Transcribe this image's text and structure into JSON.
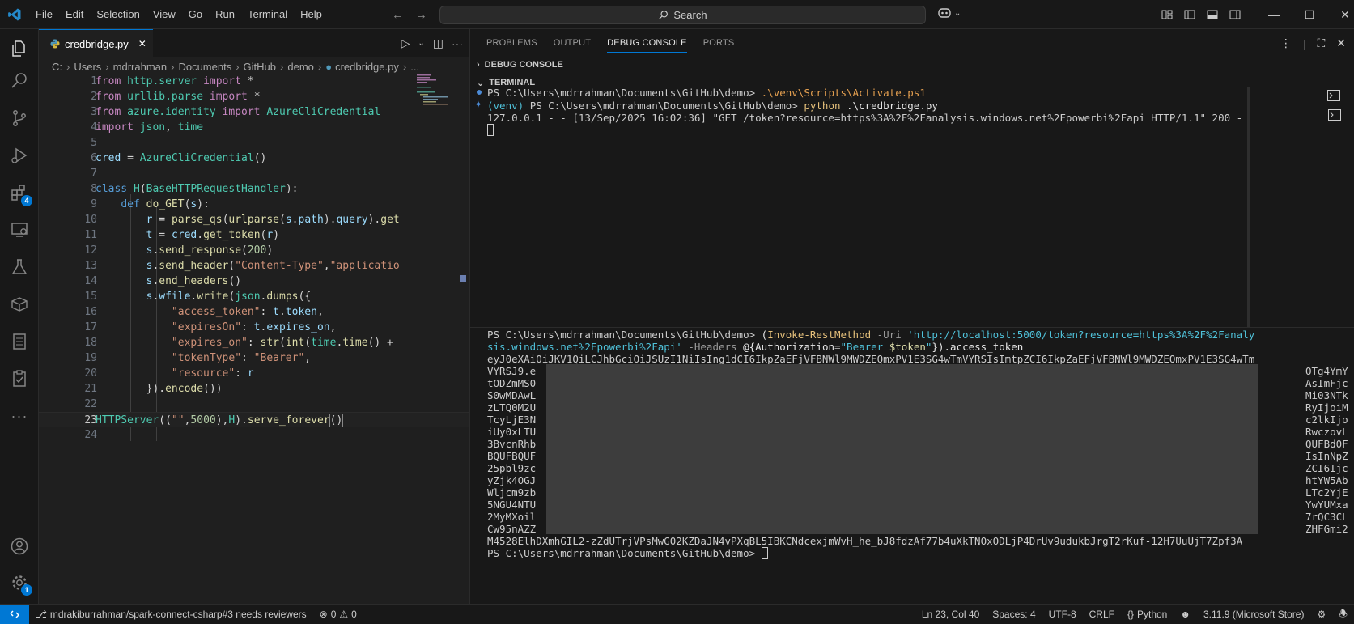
{
  "titlebar": {
    "menu": [
      "File",
      "Edit",
      "Selection",
      "View",
      "Go",
      "Run",
      "Terminal",
      "Help"
    ],
    "search_label": "Search"
  },
  "editor": {
    "tab_label": "credbridge.py",
    "breadcrumb": [
      "C:",
      "Users",
      "mdrrahman",
      "Documents",
      "GitHub",
      "demo",
      "credbridge.py",
      "..."
    ],
    "current_line": 23
  },
  "activity": {
    "extensions_badge": "4",
    "accounts_badge": "1"
  },
  "panel": {
    "tabs": [
      "PROBLEMS",
      "OUTPUT",
      "DEBUG CONSOLE",
      "PORTS"
    ],
    "active_tab": "DEBUG CONSOLE",
    "debug_console_header": "DEBUG CONSOLE",
    "terminal_header": "TERMINAL"
  },
  "terminal": {
    "line1_prompt": "PS C:\\Users\\mdrrahman\\Documents\\GitHub\\demo> ",
    "line1_cmd": ".\\venv\\Scripts\\Activate.ps1",
    "line2_venv": "(venv) ",
    "line2_prompt": "PS C:\\Users\\mdrrahman\\Documents\\GitHub\\demo> ",
    "line2_cmd": "python",
    "line2_arg": " .\\credbridge.py",
    "line3": "127.0.0.1 - - [13/Sep/2025 16:02:36] \"GET /token?resource=https%3A%2F%2Fanalysis.windows.net%2Fpowerbi%2Fapi HTTP/1.1\" 200 -",
    "cmd2_prompt": "PS C:\\Users\\mdrrahman\\Documents\\GitHub\\demo> ",
    "cmd2_paren": "(",
    "cmd2_cmdlet": "Invoke-RestMethod",
    "cmd2_uri_flag": " -Uri ",
    "cmd2_uri_a": "'http://localhost:5000/token?resource=https%3A%2F%2Fanaly",
    "cmd2_uri_b": "sis.windows.net%2Fpowerbi%2Fapi'",
    "cmd2_headers_flag": " -Headers ",
    "cmd2_headers_open": "@{",
    "cmd2_auth_key": "Authorization",
    "cmd2_eq": "=",
    "cmd2_bearer": "\"Bearer ",
    "cmd2_token_var": "$token",
    "cmd2_bearer_close": "\"",
    "cmd2_close": "}).access_token",
    "token_first": "eyJ0eXAiOiJKV1QiLCJhbGciOiJSUzI1NiIsIng1dCI6IkpZaEFjVFBNWl9MWDZEQmxPV1E3SG4wTmVYRSIsImtpZCI6IkpZaEFjVFBNWl9MWDZEQmxPV1E3SG4wTm",
    "token_left": [
      "VYRSJ9.e",
      "tODZmMS0",
      "S0wMDAwL",
      "zLTQ0M2U",
      "TcyLjE3N",
      "iUy0xLTU",
      "3BvcnRhb",
      "BQUFBQUF",
      "25pbl9zc",
      "yZjk4OGJ",
      "Wljcm9zb",
      "5NGU4NTU",
      "2MyMXoil",
      "Cw95nAZZ"
    ],
    "token_right": [
      "OTg4YmY",
      "AsImFjc",
      "Mi03NTk",
      "RyIjoiM",
      "c2lkIjo",
      "RwczovL",
      "QUFBd0F",
      "IsInNpZ",
      "ZCI6Ijc",
      "htYW5Ab",
      "LTc2YjE",
      "YwYUMxa",
      "7rQC3CL",
      "ZHFGmi2"
    ],
    "token_last": "M4528ElhDXmhGIL2-zZdUTrjVPsMwG02KZDaJN4vPXqBL5IBKCNdcexjmWvH_he_bJ8fdzAf77b4uXkTNOxODLjP4DrUv9udukbJrgT2rKuf-12H7UuUjT7Zpf3A",
    "final_prompt": "PS C:\\Users\\mdrrahman\\Documents\\GitHub\\demo> "
  },
  "statusbar": {
    "branch": "mdrakiburrahman/spark-connect-csharp#3 needs reviewers",
    "errors": "0",
    "warnings": "0",
    "position": "Ln 23, Col 40",
    "spaces": "Spaces: 4",
    "encoding": "UTF-8",
    "eol": "CRLF",
    "language": "Python",
    "interpreter": "3.11.9 (Microsoft Store)"
  },
  "colors": {
    "accent": "#0078d4",
    "background": "#1f1f1f",
    "chrome": "#181818"
  }
}
